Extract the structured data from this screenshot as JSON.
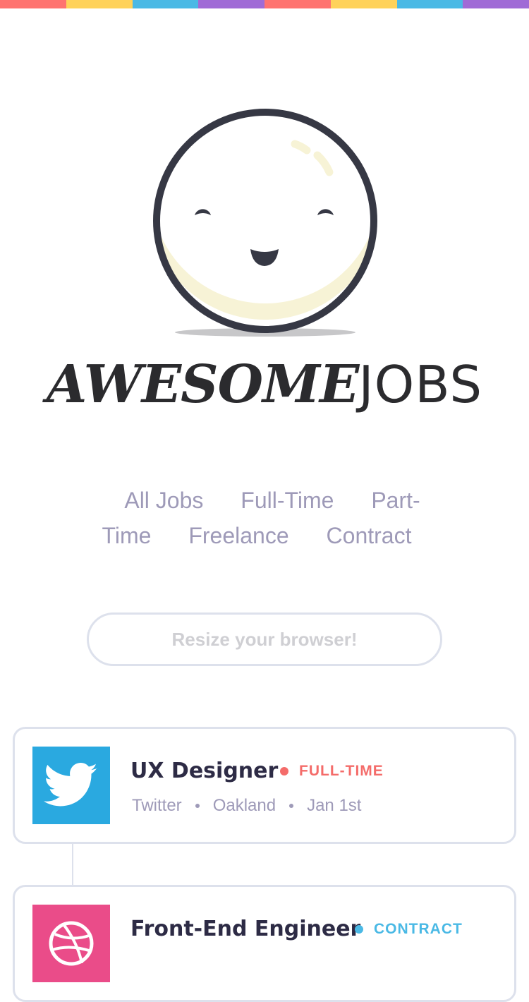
{
  "colors": {
    "stripes": [
      "#ff7370",
      "#ffd25a",
      "#4ab9e5",
      "#a06bd6",
      "#ff7370",
      "#ffd25a",
      "#4ab9e5",
      "#a06bd6"
    ],
    "brand_text": "#2b2b2e",
    "nav_text": "#9e9ab8",
    "border": "#dde1ec",
    "mascot_outline": "#363844",
    "mascot_fill": "#f7f3d6",
    "fulltime": "#f46c6a",
    "contract": "#4ab9e5",
    "twitter_bg": "#2aa9e0",
    "dribbble_bg": "#ea4c89"
  },
  "brand": {
    "bold": "AWESOME",
    "light": "JOBS"
  },
  "nav": [
    "All Jobs",
    "Full-Time",
    "Part-Time",
    "Freelance",
    "Contract"
  ],
  "search": {
    "placeholder": "Resize your browser!",
    "value": ""
  },
  "jobs": [
    {
      "title": "UX Designer",
      "type": "FULL-TIME",
      "company": "Twitter",
      "location": "Oakland",
      "date": "Jan 1st",
      "icon": "twitter-bird-icon"
    },
    {
      "title": "Front-End Engineer",
      "type": "CONTRACT",
      "icon": "dribbble-ball-icon"
    }
  ]
}
